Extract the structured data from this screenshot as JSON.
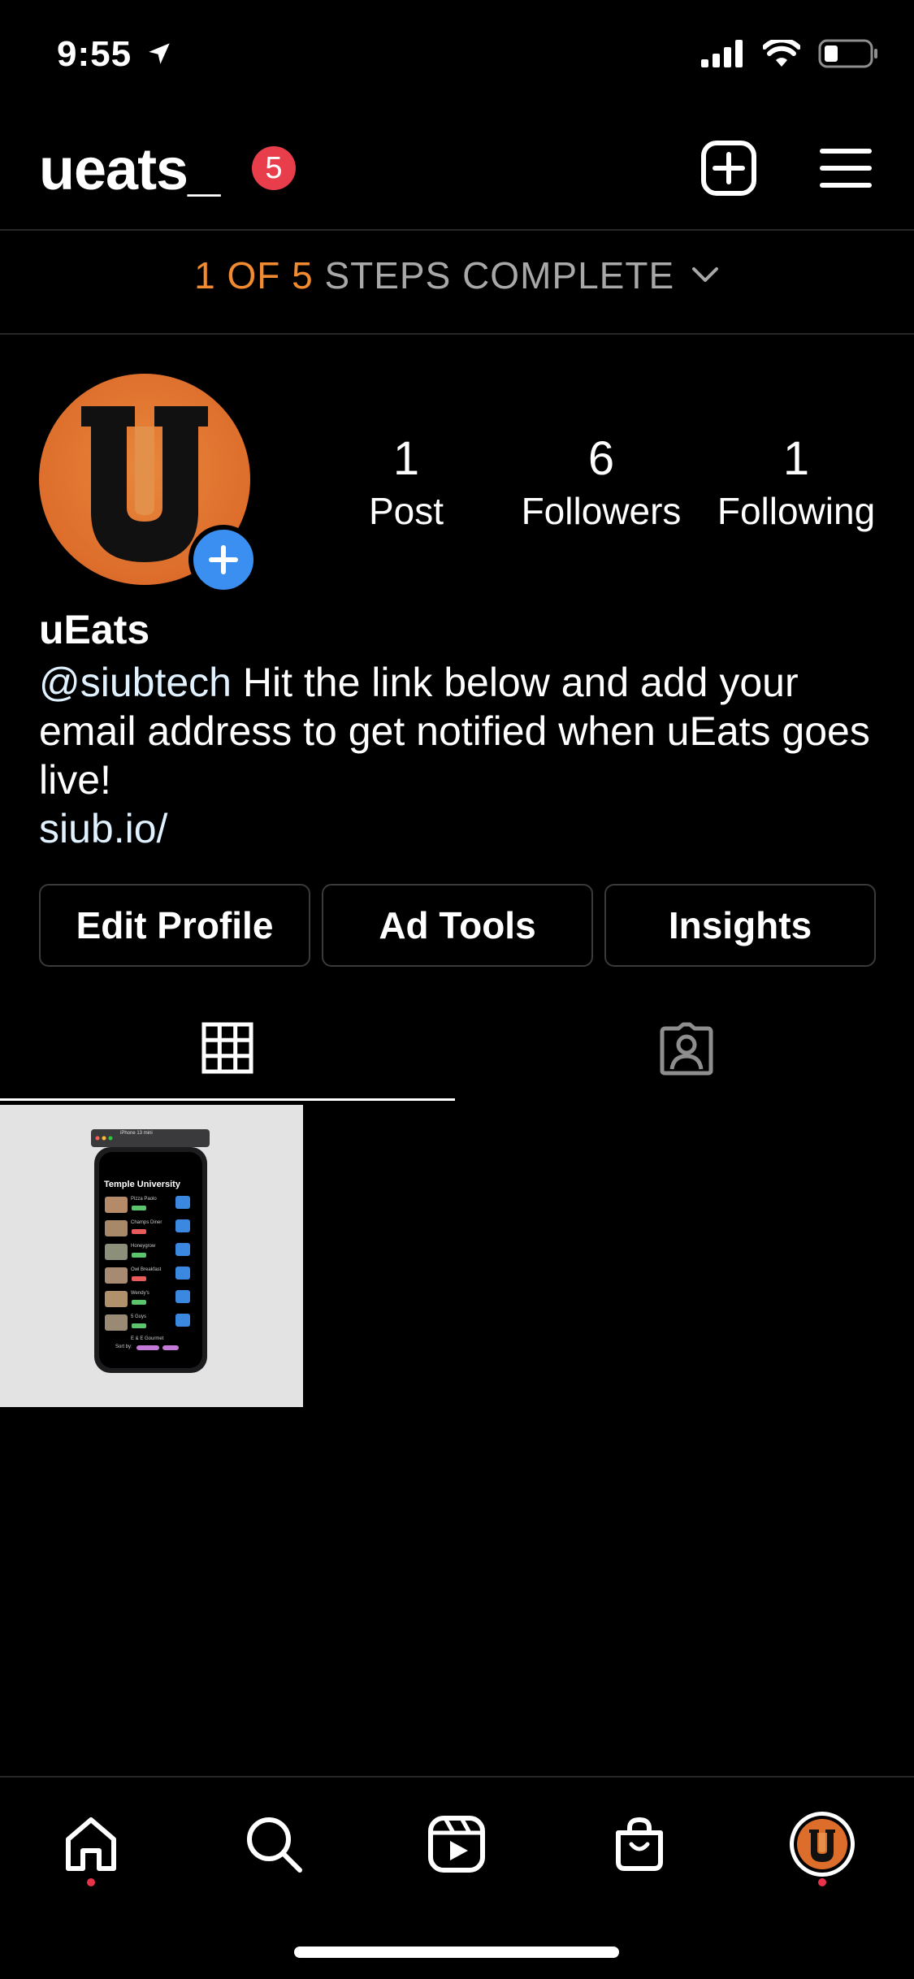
{
  "status_bar": {
    "time": "9:55"
  },
  "header": {
    "username": "ueats_",
    "notification_count": "5"
  },
  "steps": {
    "progress": "1 OF 5",
    "text": "STEPS COMPLETE"
  },
  "profile": {
    "avatar_letter": "U",
    "stats": [
      {
        "num": "1",
        "label": "Post"
      },
      {
        "num": "6",
        "label": "Followers"
      },
      {
        "num": "1",
        "label": "Following"
      }
    ],
    "display_name": "uEats",
    "bio_mention": "@siubtech",
    "bio_text": " Hit the link below and add your email address to get notified when uEats goes live!",
    "bio_link": "siub.io/"
  },
  "buttons": {
    "edit_profile": "Edit Profile",
    "ad_tools": "Ad Tools",
    "insights": "Insights"
  },
  "post_preview": {
    "window_title": "iPhone 13 mini",
    "screen_title": "Temple University",
    "restaurants": [
      "Pizza Paolo",
      "Champs Diner",
      "Honeygrow",
      "Owl Breakfast",
      "Wendy's",
      "5 Guys",
      "E & E Gourmet"
    ],
    "sort_label": "Sort by:"
  },
  "tabs": {
    "active": "grid"
  },
  "bottom_nav": [
    "home-icon",
    "search-icon",
    "reels-icon",
    "shop-icon",
    "profile-avatar"
  ],
  "colors": {
    "accent_orange": "#f28b30",
    "badge_red": "#e83e4c",
    "add_blue": "#3b8ff0",
    "avatar_orange": "#dd6d2b"
  }
}
